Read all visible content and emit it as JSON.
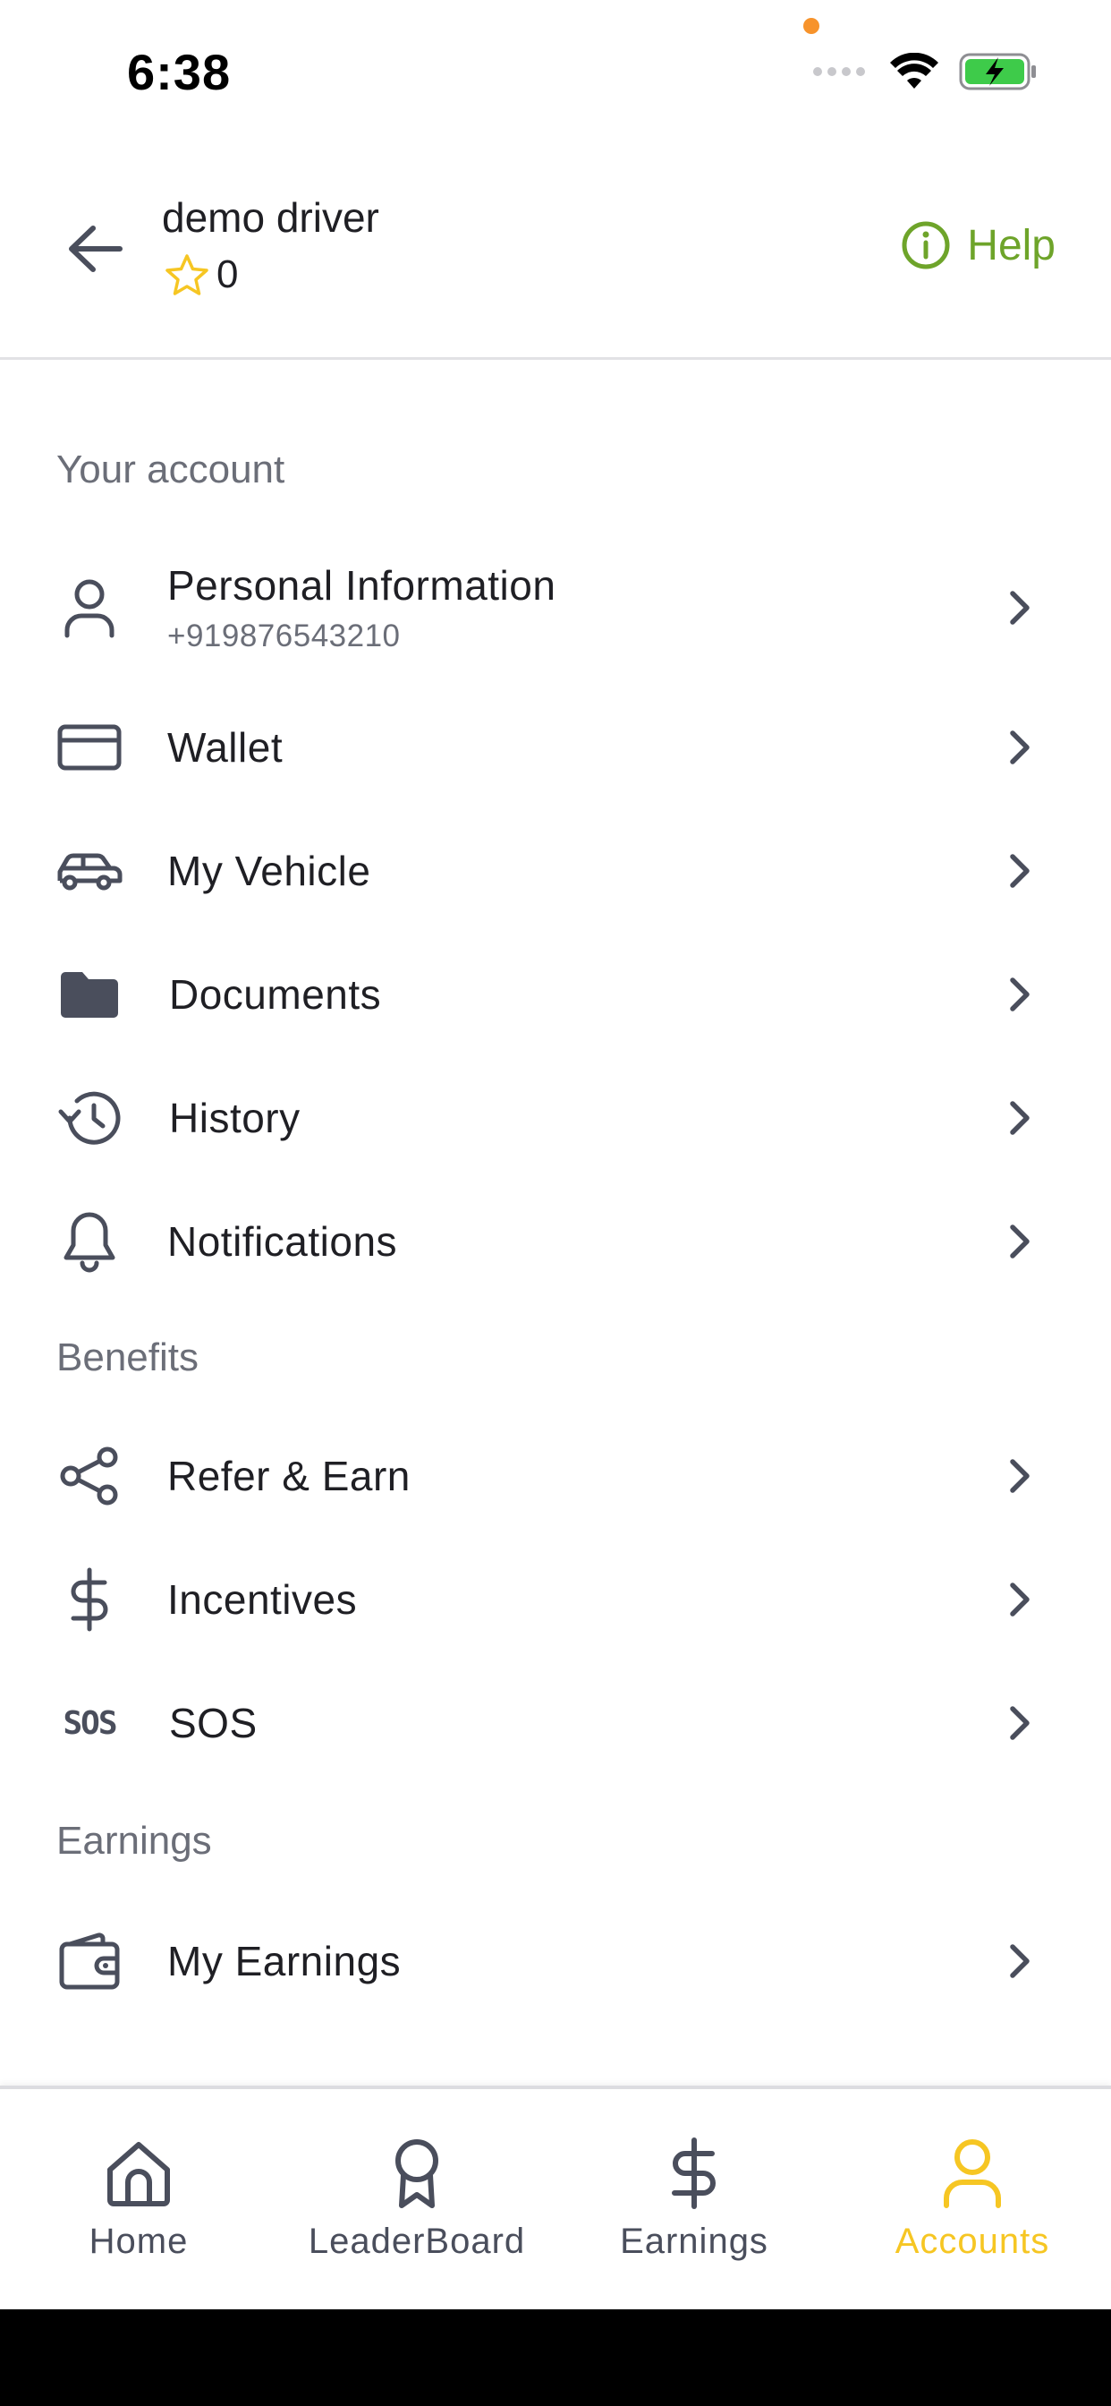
{
  "status": {
    "time": "6:38",
    "dot_color": "#f7932b",
    "battery_color": "#3ecb4a"
  },
  "header": {
    "driver_name": "demo driver",
    "rating": "0",
    "help_label": "Help",
    "accent": "#6ea42a",
    "star_color": "#f6c623"
  },
  "sections": {
    "account": "Your account",
    "benefits": "Benefits",
    "earnings": "Earnings"
  },
  "menu": {
    "personal_info": {
      "label": "Personal Information",
      "sub": "+919876543210",
      "icon": "user-icon"
    },
    "wallet": {
      "label": "Wallet",
      "icon": "credit-card-icon"
    },
    "vehicle": {
      "label": "My Vehicle",
      "icon": "car-icon"
    },
    "documents": {
      "label": "Documents",
      "icon": "folder-icon"
    },
    "history": {
      "label": "History",
      "icon": "history-icon"
    },
    "notifications": {
      "label": "Notifications",
      "icon": "bell-icon"
    },
    "refer": {
      "label": "Refer & Earn",
      "icon": "share-icon"
    },
    "incentives": {
      "label": "Incentives",
      "icon": "dollar-icon"
    },
    "sos": {
      "label": "SOS",
      "icon_text": "SOS",
      "icon": "sos-icon"
    },
    "my_earnings": {
      "label": "My Earnings",
      "icon": "wallet-icon"
    }
  },
  "nav": {
    "home": "Home",
    "leaderboard": "LeaderBoard",
    "earnings": "Earnings",
    "accounts": "Accounts",
    "active_color": "#f6c623",
    "inactive_color": "#4a4e5c"
  }
}
